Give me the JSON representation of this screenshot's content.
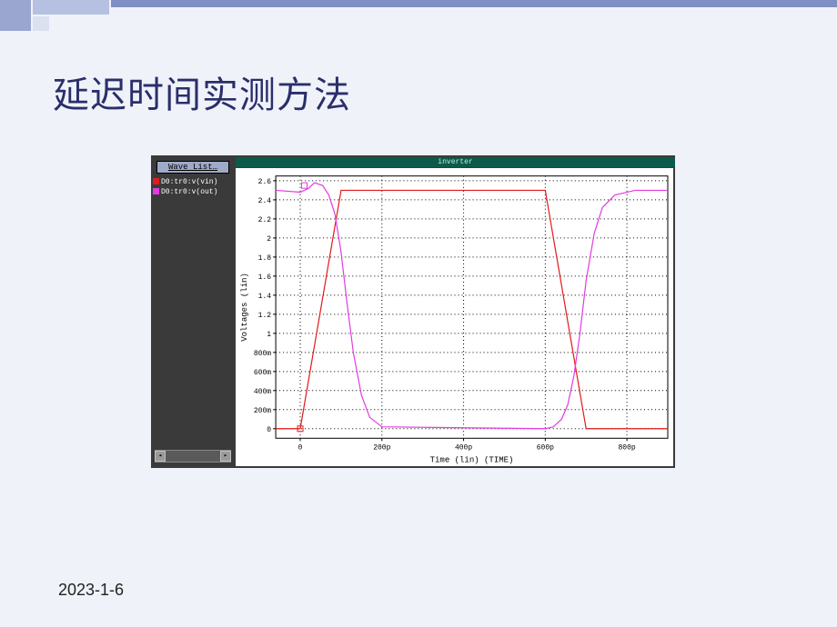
{
  "slide": {
    "title": "延迟时间实测方法",
    "date": "2023-1-6"
  },
  "sidebar": {
    "wave_button": "Wave List…",
    "legend": [
      {
        "label": "D0:tr0:v(vin)",
        "color": "#e11a1a"
      },
      {
        "label": "D0:tr0:v(out)",
        "color": "#e23be2"
      }
    ],
    "scroll_left": "◂",
    "scroll_right": "▸"
  },
  "chart_window_title": "inverter",
  "chart_data": {
    "type": "line",
    "title": "inverter",
    "xlabel": "Time (lin) (TIME)",
    "ylabel": "Voltages (lin)",
    "xlim": [
      -60,
      900
    ],
    "ylim": [
      -0.1,
      2.65
    ],
    "x_ticks": [
      0,
      200,
      400,
      600,
      800
    ],
    "x_tick_labels": [
      "0",
      "200p",
      "400p",
      "600p",
      "800p"
    ],
    "y_ticks": [
      0,
      0.2,
      0.4,
      0.6,
      0.8,
      1.0,
      1.2,
      1.4,
      1.6,
      1.8,
      2.0,
      2.2,
      2.4,
      2.6
    ],
    "y_tick_labels": [
      "0",
      "200m",
      "400m",
      "600m",
      "800m",
      "1",
      "1.2",
      "1.4",
      "1.6",
      "1.8",
      "2",
      "2.2",
      "2.4",
      "2.6"
    ],
    "series": [
      {
        "name": "v(vin)",
        "color": "#e11a1a",
        "x": [
          -60,
          0,
          100,
          600,
          700,
          900
        ],
        "y": [
          0,
          0,
          2.5,
          2.5,
          0,
          0
        ]
      },
      {
        "name": "v(out)",
        "color": "#e23be2",
        "x": [
          -60,
          0,
          20,
          35,
          55,
          70,
          85,
          100,
          115,
          130,
          150,
          170,
          200,
          600,
          620,
          640,
          655,
          670,
          685,
          700,
          720,
          740,
          770,
          820,
          900
        ],
        "y": [
          2.5,
          2.48,
          2.52,
          2.58,
          2.55,
          2.45,
          2.25,
          1.85,
          1.3,
          0.8,
          0.35,
          0.12,
          0.02,
          0.0,
          0.02,
          0.1,
          0.25,
          0.55,
          1.0,
          1.55,
          2.05,
          2.32,
          2.45,
          2.5,
          2.5
        ]
      }
    ]
  }
}
